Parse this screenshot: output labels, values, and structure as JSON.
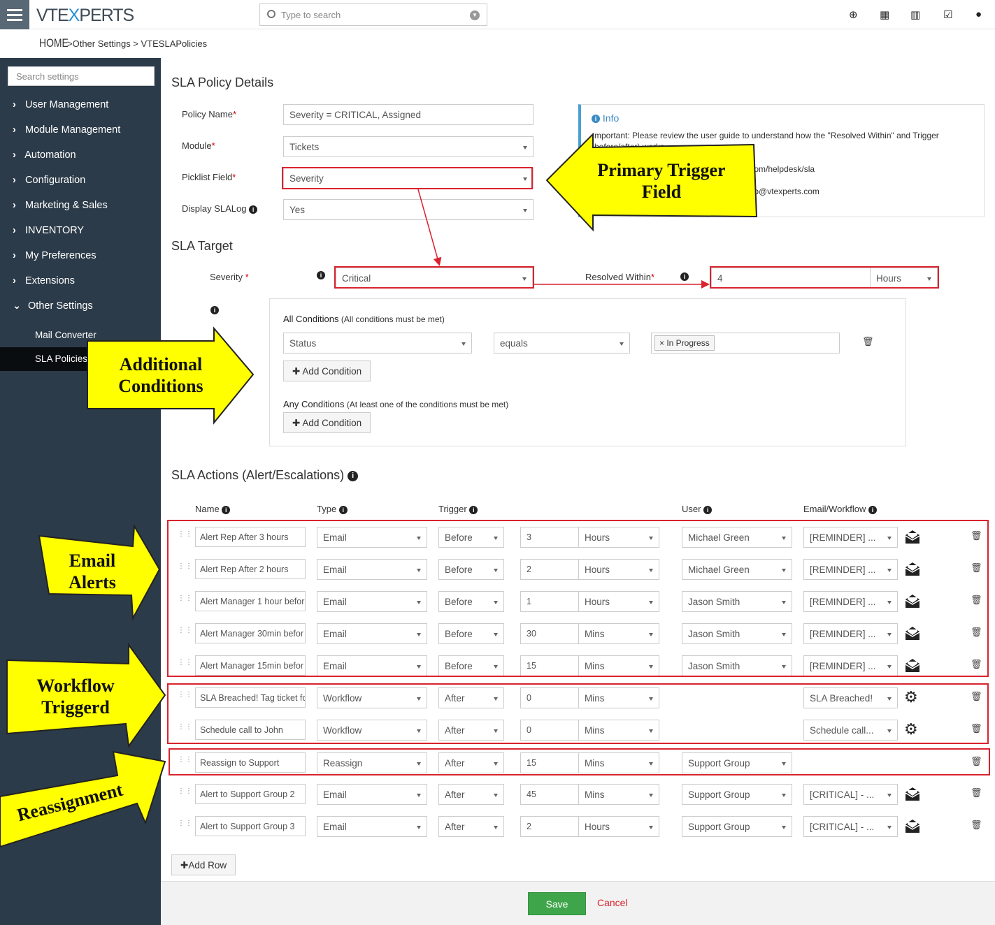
{
  "header": {
    "logo_a": "VTE",
    "logo_b": "X",
    "logo_c": "PERTS",
    "search_placeholder": "Type to search"
  },
  "breadcrumb": {
    "home": "HOME",
    "rest": ">Other Settings > VTESLAPolicies"
  },
  "sidebar": {
    "search_placeholder": "Search settings",
    "items": [
      "User Management",
      "Module Management",
      "Automation",
      "Configuration",
      "Marketing & Sales",
      "INVENTORY",
      "My Preferences",
      "Extensions",
      "Other Settings"
    ],
    "subitems": [
      "Mail Converter",
      "SLA Policies"
    ]
  },
  "details": {
    "title": "SLA Policy Details",
    "policy_name_label": "Policy Name",
    "policy_name": "Severity = CRITICAL, Assigned",
    "module_label": "Module",
    "module": "Tickets",
    "picklist_label": "Picklist Field",
    "picklist": "Severity",
    "display_label": "Display SLALog",
    "display": "Yes"
  },
  "info": {
    "title": "Info",
    "line1": "mportant: Please review the user guide to understand how the \"Resolved Within\" and Trigger",
    "line2": "before/after) works",
    "line3": ".com/helpdesk/sla",
    "line4": "elp@vtexperts.com"
  },
  "target": {
    "title": "SLA Target",
    "severity_label": "Severity",
    "severity": "Critical",
    "resolved_label": "Resolved Within",
    "resolved_value": "4",
    "resolved_unit": "Hours"
  },
  "conditions": {
    "all_title": "All Conditions",
    "all_note": " (All conditions must be met)",
    "field": "Status",
    "operator": "equals",
    "value": "In Progress",
    "add_label": "Add Condition",
    "any_title": "Any Conditions",
    "any_note": " (At least one of the conditions must be met)"
  },
  "actions": {
    "title": "SLA Actions (Alert/Escalations)",
    "headers": {
      "name": "Name",
      "type": "Type",
      "trigger": "Trigger",
      "user": "User",
      "email": "Email/Workflow"
    },
    "rows": [
      {
        "name": "Alert Rep After 3 hours",
        "type": "Email",
        "trigger": "Before",
        "amount": "3",
        "unit": "Hours",
        "user": "Michael Green",
        "email": "[REMINDER] ...",
        "icon": "envelope-icon"
      },
      {
        "name": "Alert Rep After 2 hours",
        "type": "Email",
        "trigger": "Before",
        "amount": "2",
        "unit": "Hours",
        "user": "Michael Green",
        "email": "[REMINDER] ...",
        "icon": "envelope-icon"
      },
      {
        "name": "Alert Manager 1 hour befor",
        "type": "Email",
        "trigger": "Before",
        "amount": "1",
        "unit": "Hours",
        "user": "Jason Smith",
        "email": "[REMINDER] ...",
        "icon": "envelope-icon"
      },
      {
        "name": "Alert Manager 30min befor",
        "type": "Email",
        "trigger": "Before",
        "amount": "30",
        "unit": "Mins",
        "user": "Jason Smith",
        "email": "[REMINDER] ...",
        "icon": "envelope-icon"
      },
      {
        "name": "Alert Manager 15min befor",
        "type": "Email",
        "trigger": "Before",
        "amount": "15",
        "unit": "Mins",
        "user": "Jason Smith",
        "email": "[REMINDER] ...",
        "icon": "envelope-icon"
      },
      {
        "name": "SLA Breached! Tag ticket fo",
        "type": "Workflow",
        "trigger": "After",
        "amount": "0",
        "unit": "Mins",
        "user": "",
        "email": "SLA Breached!",
        "icon": "gear-icon"
      },
      {
        "name": "Schedule call to John",
        "type": "Workflow",
        "trigger": "After",
        "amount": "0",
        "unit": "Mins",
        "user": "",
        "email": "Schedule call...",
        "icon": "gear-icon"
      },
      {
        "name": "Reassign to Support",
        "type": "Reassign",
        "trigger": "After",
        "amount": "15",
        "unit": "Mins",
        "user": "Support Group",
        "email": "",
        "icon": ""
      },
      {
        "name": "Alert to Support Group 2",
        "type": "Email",
        "trigger": "After",
        "amount": "45",
        "unit": "Mins",
        "user": "Support Group",
        "email": "[CRITICAL] - ...",
        "icon": "envelope-icon"
      },
      {
        "name": "Alert to Support Group 3",
        "type": "Email",
        "trigger": "After",
        "amount": "2",
        "unit": "Hours",
        "user": "Support Group",
        "email": "[CRITICAL] - ...",
        "icon": "envelope-icon"
      }
    ],
    "add_row": "Add Row"
  },
  "footer": {
    "save": "Save",
    "cancel": "Cancel"
  },
  "callouts": {
    "primary_1": "Primary Trigger",
    "primary_2": "Field",
    "additional_1": "Additional",
    "additional_2": "Conditions",
    "email_1": "Email",
    "email_2": "Alerts",
    "workflow_1": "Workflow",
    "workflow_2": "Triggerd",
    "reassign": "Reassignment"
  },
  "colors": {
    "sidebar": "#2c3b49",
    "accent": "#2a8fd6",
    "highlight": "#d9232e",
    "callout": "#ffff00",
    "save": "#3fa54b"
  }
}
